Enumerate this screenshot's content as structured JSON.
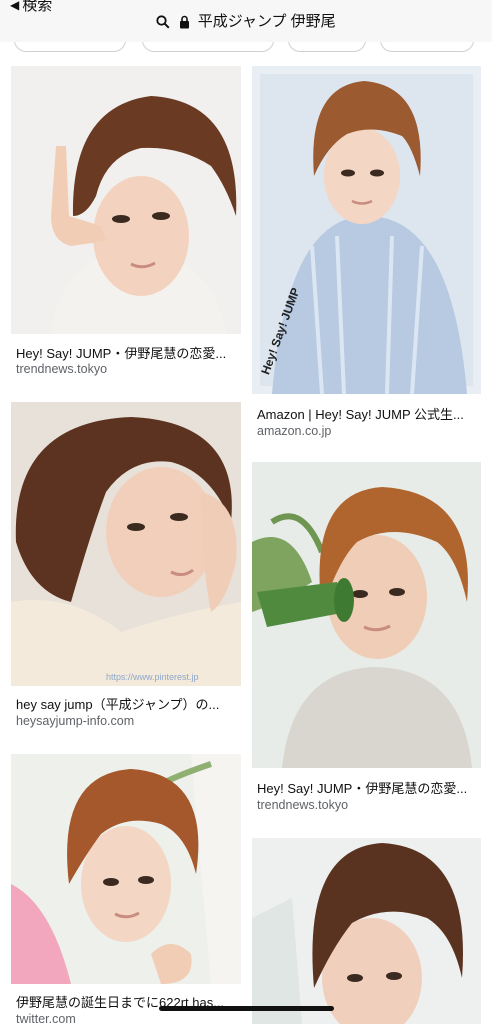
{
  "header": {
    "back_label": "検索",
    "url_text": "平成ジャンプ 伊野尾"
  },
  "results": [
    {
      "title": "Hey! Say! JUMP・伊野尾慧の恋愛...",
      "source": "trendnews.tokyo"
    },
    {
      "title": "Amazon | Hey! Say! JUMP 公式生...",
      "source": "amazon.co.jp",
      "image_text": "Hey! Say! JUMP"
    },
    {
      "title": "hey say jump（平成ジャンプ）の...",
      "source": "heysayjump-info.com",
      "image_text": "https://www.pinterest.jp"
    },
    {
      "title": "Hey! Say! JUMP・伊野尾慧の恋愛...",
      "source": "trendnews.tokyo"
    },
    {
      "title": "伊野尾慧の誕生日までに622rt has...",
      "source": "twitter.com"
    },
    {
      "title": "",
      "source": ""
    }
  ],
  "colors": {
    "topbar_bg": "#f7f7f7",
    "source_text": "#5f6368",
    "hair_brown": "#6b3a22",
    "skin": "#f3d6c3"
  }
}
